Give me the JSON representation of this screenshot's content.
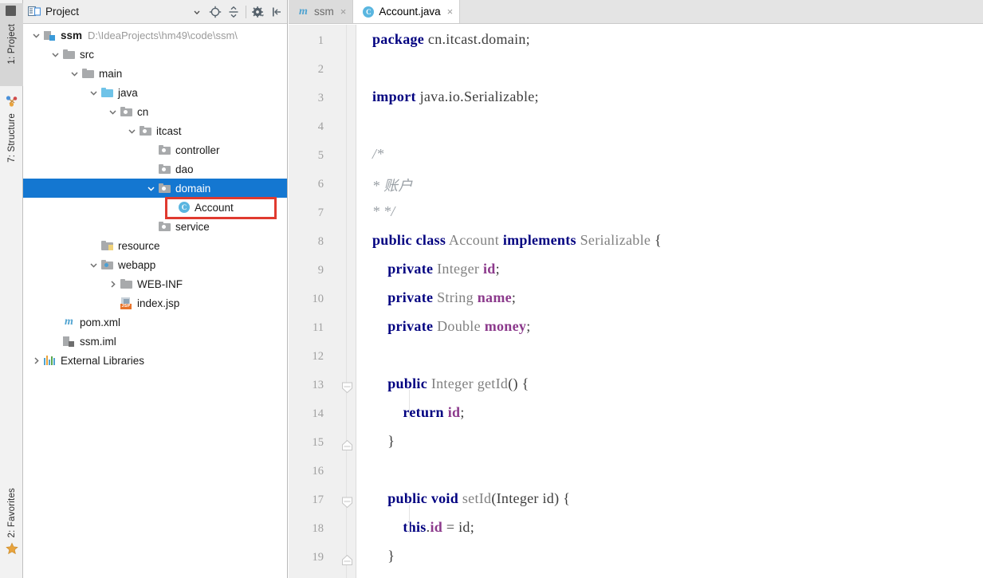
{
  "left_toolbar": {
    "buttons": [
      {
        "id": "project",
        "label": "1: Project",
        "icon": "project-window-icon",
        "active": true
      },
      {
        "id": "structure",
        "label": "7: Structure",
        "icon": "structure-icon",
        "active": false
      },
      {
        "id": "favorites",
        "label": "2: Favorites",
        "icon": "star-icon",
        "active": false
      }
    ]
  },
  "project_panel": {
    "title": "Project",
    "title_icon": "project-view-icon",
    "toolbar": [
      {
        "name": "view-options-dropdown",
        "glyph": "▾"
      },
      {
        "name": "scroll-from-source-icon",
        "glyph": "target"
      },
      {
        "name": "collapse-all-icon",
        "glyph": "collapse"
      },
      {
        "name": "settings-gear-icon",
        "glyph": "gear"
      },
      {
        "name": "hide-panel-icon",
        "glyph": "hide"
      }
    ],
    "tree": [
      {
        "id": "ssm-root",
        "label": "ssm",
        "sub": "D:\\IdeaProjects\\hm49\\code\\ssm\\",
        "depth": 0,
        "twisty": "down",
        "icon": "module-icon",
        "bold": true,
        "selected": false
      },
      {
        "id": "src",
        "label": "src",
        "sub": "",
        "depth": 1,
        "twisty": "down",
        "icon": "folder-grey-icon",
        "bold": false,
        "selected": false
      },
      {
        "id": "main",
        "label": "main",
        "sub": "",
        "depth": 2,
        "twisty": "down",
        "icon": "folder-grey-icon",
        "bold": false,
        "selected": false
      },
      {
        "id": "java",
        "label": "java",
        "sub": "",
        "depth": 3,
        "twisty": "down",
        "icon": "folder-source-icon",
        "bold": false,
        "selected": false
      },
      {
        "id": "cn",
        "label": "cn",
        "sub": "",
        "depth": 4,
        "twisty": "down",
        "icon": "package-icon",
        "bold": false,
        "selected": false
      },
      {
        "id": "itcast",
        "label": "itcast",
        "sub": "",
        "depth": 5,
        "twisty": "down",
        "icon": "package-icon",
        "bold": false,
        "selected": false
      },
      {
        "id": "controller",
        "label": "controller",
        "sub": "",
        "depth": 6,
        "twisty": "none",
        "icon": "package-icon",
        "bold": false,
        "selected": false
      },
      {
        "id": "dao",
        "label": "dao",
        "sub": "",
        "depth": 6,
        "twisty": "none",
        "icon": "package-icon",
        "bold": false,
        "selected": false
      },
      {
        "id": "domain",
        "label": "domain",
        "sub": "",
        "depth": 6,
        "twisty": "down",
        "icon": "package-icon",
        "bold": false,
        "selected": true
      },
      {
        "id": "account-class",
        "label": "Account",
        "sub": "",
        "depth": 7,
        "twisty": "none",
        "icon": "java-class-icon",
        "bold": false,
        "selected": false
      },
      {
        "id": "service",
        "label": "service",
        "sub": "",
        "depth": 6,
        "twisty": "none",
        "icon": "package-icon",
        "bold": false,
        "selected": false
      },
      {
        "id": "resource",
        "label": "resource",
        "sub": "",
        "depth": 3,
        "twisty": "none",
        "icon": "folder-resource-icon",
        "bold": false,
        "selected": false
      },
      {
        "id": "webapp",
        "label": "webapp",
        "sub": "",
        "depth": 3,
        "twisty": "down",
        "icon": "folder-web-icon",
        "bold": false,
        "selected": false
      },
      {
        "id": "web-inf",
        "label": "WEB-INF",
        "sub": "",
        "depth": 4,
        "twisty": "right",
        "icon": "folder-grey-icon",
        "bold": false,
        "selected": false
      },
      {
        "id": "index-jsp",
        "label": "index.jsp",
        "sub": "",
        "depth": 4,
        "twisty": "none",
        "icon": "jsp-file-icon",
        "bold": false,
        "selected": false
      },
      {
        "id": "pom-xml",
        "label": "pom.xml",
        "sub": "",
        "depth": 1,
        "twisty": "none",
        "icon": "maven-file-icon",
        "bold": false,
        "selected": false
      },
      {
        "id": "ssm-iml",
        "label": "ssm.iml",
        "sub": "",
        "depth": 1,
        "twisty": "none",
        "icon": "iml-file-icon",
        "bold": false,
        "selected": false
      },
      {
        "id": "external-libs",
        "label": "External Libraries",
        "sub": "",
        "depth": 0,
        "twisty": "right",
        "icon": "library-icon",
        "bold": false,
        "selected": false
      }
    ],
    "highlight": {
      "target": "account-class",
      "color": "#e03a2f"
    }
  },
  "editor": {
    "tabs": [
      {
        "id": "ssm",
        "label": "ssm",
        "icon": "maven-file-icon",
        "active": false,
        "close": "×"
      },
      {
        "id": "account-java",
        "label": "Account.java",
        "icon": "java-class-icon",
        "active": true,
        "close": "×"
      }
    ],
    "first_line": 1,
    "line_numbers": [
      "1",
      "2",
      "3",
      "4",
      "5",
      "6",
      "7",
      "8",
      "9",
      "10",
      "11",
      "12",
      "13",
      "14",
      "15",
      "16",
      "17",
      "18",
      "19"
    ],
    "fold_markers": [
      {
        "line": 13,
        "type": "expanded-start"
      },
      {
        "line": 15,
        "type": "expanded-end"
      },
      {
        "line": 17,
        "type": "expanded-start"
      },
      {
        "line": 19,
        "type": "expanded-end"
      }
    ],
    "code_lines": [
      {
        "n": 1,
        "tokens": [
          {
            "t": "kw",
            "v": "package"
          },
          {
            "t": "pl",
            "v": " cn.itcast.domain;"
          }
        ]
      },
      {
        "n": 2,
        "tokens": []
      },
      {
        "n": 3,
        "tokens": [
          {
            "t": "kw",
            "v": "import"
          },
          {
            "t": "pl",
            "v": " java.io.Serializable;"
          }
        ]
      },
      {
        "n": 4,
        "tokens": []
      },
      {
        "n": 5,
        "tokens": [
          {
            "t": "cm",
            "v": "/*"
          }
        ]
      },
      {
        "n": 6,
        "tokens": [
          {
            "t": "cm",
            "v": "* 账户"
          }
        ]
      },
      {
        "n": 7,
        "tokens": [
          {
            "t": "cm",
            "v": "* */"
          }
        ]
      },
      {
        "n": 8,
        "tokens": [
          {
            "t": "kw",
            "v": "public class"
          },
          {
            "t": "ty",
            "v": " Account "
          },
          {
            "t": "kw",
            "v": "implements"
          },
          {
            "t": "ty",
            "v": " Serializable "
          },
          {
            "t": "pl",
            "v": "{"
          }
        ]
      },
      {
        "n": 9,
        "tokens": [
          {
            "t": "pl",
            "v": "    "
          },
          {
            "t": "kw",
            "v": "private"
          },
          {
            "t": "ty",
            "v": " Integer "
          },
          {
            "t": "fld",
            "v": "id"
          },
          {
            "t": "pl",
            "v": ";"
          }
        ]
      },
      {
        "n": 10,
        "tokens": [
          {
            "t": "pl",
            "v": "    "
          },
          {
            "t": "kw",
            "v": "private"
          },
          {
            "t": "ty",
            "v": " String "
          },
          {
            "t": "fld",
            "v": "name"
          },
          {
            "t": "pl",
            "v": ";"
          }
        ]
      },
      {
        "n": 11,
        "tokens": [
          {
            "t": "pl",
            "v": "    "
          },
          {
            "t": "kw",
            "v": "private"
          },
          {
            "t": "ty",
            "v": " Double "
          },
          {
            "t": "fld",
            "v": "money"
          },
          {
            "t": "pl",
            "v": ";"
          }
        ]
      },
      {
        "n": 12,
        "tokens": []
      },
      {
        "n": 13,
        "tokens": [
          {
            "t": "pl",
            "v": "    "
          },
          {
            "t": "kw",
            "v": "public"
          },
          {
            "t": "ty",
            "v": " Integer "
          },
          {
            "t": "ty",
            "v": "getId"
          },
          {
            "t": "pl",
            "v": "() {"
          }
        ]
      },
      {
        "n": 14,
        "tokens": [
          {
            "t": "pl",
            "v": "        "
          },
          {
            "t": "kw",
            "v": "return"
          },
          {
            "t": "pl",
            "v": " "
          },
          {
            "t": "fld",
            "v": "id"
          },
          {
            "t": "pl",
            "v": ";"
          }
        ]
      },
      {
        "n": 15,
        "tokens": [
          {
            "t": "pl",
            "v": "    }"
          }
        ]
      },
      {
        "n": 16,
        "tokens": []
      },
      {
        "n": 17,
        "tokens": [
          {
            "t": "pl",
            "v": "    "
          },
          {
            "t": "kw",
            "v": "public void"
          },
          {
            "t": "ty",
            "v": " setId"
          },
          {
            "t": "pl",
            "v": "(Integer id) {"
          }
        ]
      },
      {
        "n": 18,
        "tokens": [
          {
            "t": "pl",
            "v": "        "
          },
          {
            "t": "kw",
            "v": "this"
          },
          {
            "t": "pl",
            "v": "."
          },
          {
            "t": "fld",
            "v": "id"
          },
          {
            "t": "pl",
            "v": " = id;"
          }
        ]
      },
      {
        "n": 19,
        "tokens": [
          {
            "t": "pl",
            "v": "    }"
          }
        ]
      }
    ]
  },
  "colors": {
    "selection_blue": "#1477d1",
    "keyword_navy": "#000080",
    "field_purple": "#8c3a8c",
    "comment_grey": "#9aa0a6",
    "type_grey": "#808080",
    "annotation_red": "#e03a2f",
    "gutter_bg": "#f0f0f0",
    "panel_bg": "#eeeeee"
  }
}
